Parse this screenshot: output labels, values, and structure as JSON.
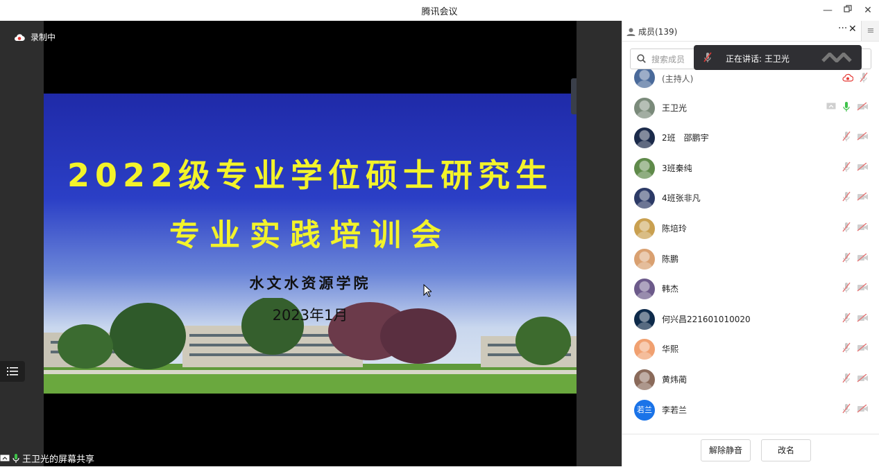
{
  "window": {
    "title": "腾讯会议"
  },
  "recording": {
    "label": "录制中"
  },
  "share": {
    "label": "王卫光的屏幕共享"
  },
  "slide": {
    "title_line1": "2022级专业学位硕士研究生",
    "title_line2": "专业实践培训会",
    "org": "水文水资源学院",
    "date": "2023年1月"
  },
  "panel": {
    "title": "成员(139)",
    "more": "···",
    "search_placeholder": "搜索成员",
    "speaking_toast": "正在讲话: 王卫光"
  },
  "members": [
    {
      "name": "(主持人)",
      "avatar_color": "#4a6a9a",
      "mic": "muted",
      "cam": "record",
      "partial": true
    },
    {
      "name": "王卫光",
      "avatar_color": "#7a8a7a",
      "mic": "active",
      "cam": "off",
      "screen": true
    },
    {
      "name": "2班　邵鹏宇",
      "avatar_color": "#1b2a4a",
      "mic": "muted",
      "cam": "off"
    },
    {
      "name": "3班秦纯",
      "avatar_color": "#5f8a4a",
      "mic": "muted",
      "cam": "off"
    },
    {
      "name": "4班张非凡",
      "avatar_color": "#2c3a66",
      "mic": "muted",
      "cam": "off"
    },
    {
      "name": "陈培玲",
      "avatar_color": "#c9a050",
      "mic": "muted",
      "cam": "off"
    },
    {
      "name": "陈鹏",
      "avatar_color": "#d9a070",
      "mic": "muted",
      "cam": "off"
    },
    {
      "name": "韩杰",
      "avatar_color": "#6c5a8a",
      "mic": "muted",
      "cam": "off"
    },
    {
      "name": "何兴昌221601010020",
      "avatar_color": "#0e2a4a",
      "mic": "muted",
      "cam": "off"
    },
    {
      "name": "华熙",
      "avatar_color": "#f0a070",
      "mic": "muted",
      "cam": "off"
    },
    {
      "name": "黄炜蔺",
      "avatar_color": "#8a6a5a",
      "mic": "muted",
      "cam": "off"
    },
    {
      "name": "李若兰",
      "avatar_color": "#1a73e8",
      "avatar_text": "若兰",
      "mic": "muted",
      "cam": "off"
    }
  ],
  "footer": {
    "unmute_all": "解除静音",
    "rename": "改名"
  }
}
